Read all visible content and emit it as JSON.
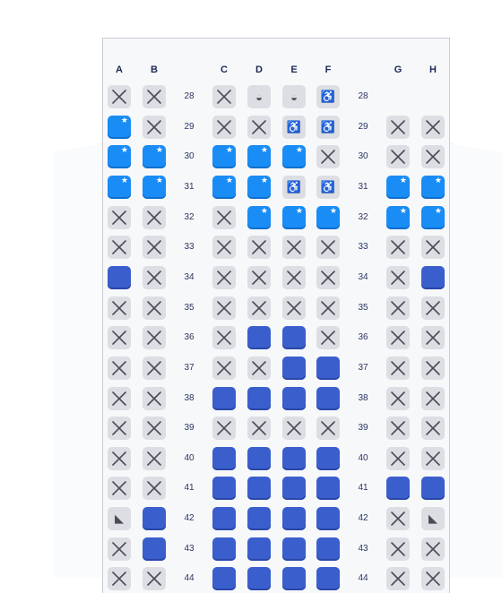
{
  "columns_left": [
    "A",
    "B"
  ],
  "columns_middle": [
    "C",
    "D",
    "E",
    "F"
  ],
  "columns_right": [
    "G",
    "H"
  ],
  "legend_icons": {
    "occupied": "x-icon",
    "preferred": "star-icon",
    "bassinet": "bassinet-icon",
    "accessible": "wheelchair-icon",
    "pet": "pet-icon"
  },
  "colors": {
    "available": "#3a5fcd",
    "preferred": "#1a8cf5",
    "occupied": "#dcdee3"
  },
  "rows": [
    {
      "num": "28",
      "seats": {
        "A": "X",
        "B": "X",
        "C": "X",
        "D": "bassinet",
        "E": "bassinet",
        "F": "wheelchair"
      }
    },
    {
      "num": "29",
      "seats": {
        "A": "P",
        "B": "X",
        "C": "X",
        "D": "X",
        "E": "wheelchair",
        "F": "wheelchair",
        "G": "X",
        "H": "X"
      }
    },
    {
      "num": "30",
      "seats": {
        "A": "P",
        "B": "P",
        "C": "P",
        "D": "P",
        "E": "P",
        "F": "X",
        "G": "X",
        "H": "X"
      }
    },
    {
      "num": "31",
      "seats": {
        "A": "P",
        "B": "P",
        "C": "P",
        "D": "P",
        "E": "wheelchair",
        "F": "wheelchair",
        "G": "P",
        "H": "P"
      }
    },
    {
      "num": "32",
      "seats": {
        "A": "X",
        "B": "X",
        "C": "X",
        "D": "P",
        "E": "P",
        "F": "P",
        "G": "P",
        "H": "P"
      }
    },
    {
      "num": "33",
      "seats": {
        "A": "X",
        "B": "X",
        "C": "X",
        "D": "X",
        "E": "X",
        "F": "X",
        "G": "X",
        "H": "X"
      }
    },
    {
      "num": "34",
      "seats": {
        "A": "A",
        "B": "X",
        "C": "X",
        "D": "X",
        "E": "X",
        "F": "X",
        "G": "X",
        "H": "A"
      }
    },
    {
      "num": "35",
      "seats": {
        "A": "X",
        "B": "X",
        "C": "X",
        "D": "X",
        "E": "X",
        "F": "X",
        "G": "X",
        "H": "X"
      }
    },
    {
      "num": "36",
      "seats": {
        "A": "X",
        "B": "X",
        "C": "X",
        "D": "A",
        "E": "A",
        "F": "X",
        "G": "X",
        "H": "X"
      }
    },
    {
      "num": "37",
      "seats": {
        "A": "X",
        "B": "X",
        "C": "X",
        "D": "X",
        "E": "A",
        "F": "A",
        "G": "X",
        "H": "X"
      }
    },
    {
      "num": "38",
      "seats": {
        "A": "X",
        "B": "X",
        "C": "A",
        "D": "A",
        "E": "A",
        "F": "A",
        "G": "X",
        "H": "X"
      }
    },
    {
      "num": "39",
      "seats": {
        "A": "X",
        "B": "X",
        "C": "X",
        "D": "X",
        "E": "X",
        "F": "X",
        "G": "X",
        "H": "X"
      }
    },
    {
      "num": "40",
      "seats": {
        "A": "X",
        "B": "X",
        "C": "A",
        "D": "A",
        "E": "A",
        "F": "A",
        "G": "X",
        "H": "X"
      }
    },
    {
      "num": "41",
      "seats": {
        "A": "X",
        "B": "X",
        "C": "A",
        "D": "A",
        "E": "A",
        "F": "A",
        "G": "A",
        "H": "A"
      }
    },
    {
      "num": "42",
      "seats": {
        "A": "pet",
        "B": "A",
        "C": "A",
        "D": "A",
        "E": "A",
        "F": "A",
        "G": "X",
        "H": "pet"
      }
    },
    {
      "num": "43",
      "seats": {
        "A": "X",
        "B": "A",
        "C": "A",
        "D": "A",
        "E": "A",
        "F": "A",
        "G": "X",
        "H": "X"
      }
    },
    {
      "num": "44",
      "seats": {
        "A": "X",
        "B": "X",
        "C": "A",
        "D": "A",
        "E": "A",
        "F": "A",
        "G": "X",
        "H": "X"
      }
    }
  ]
}
